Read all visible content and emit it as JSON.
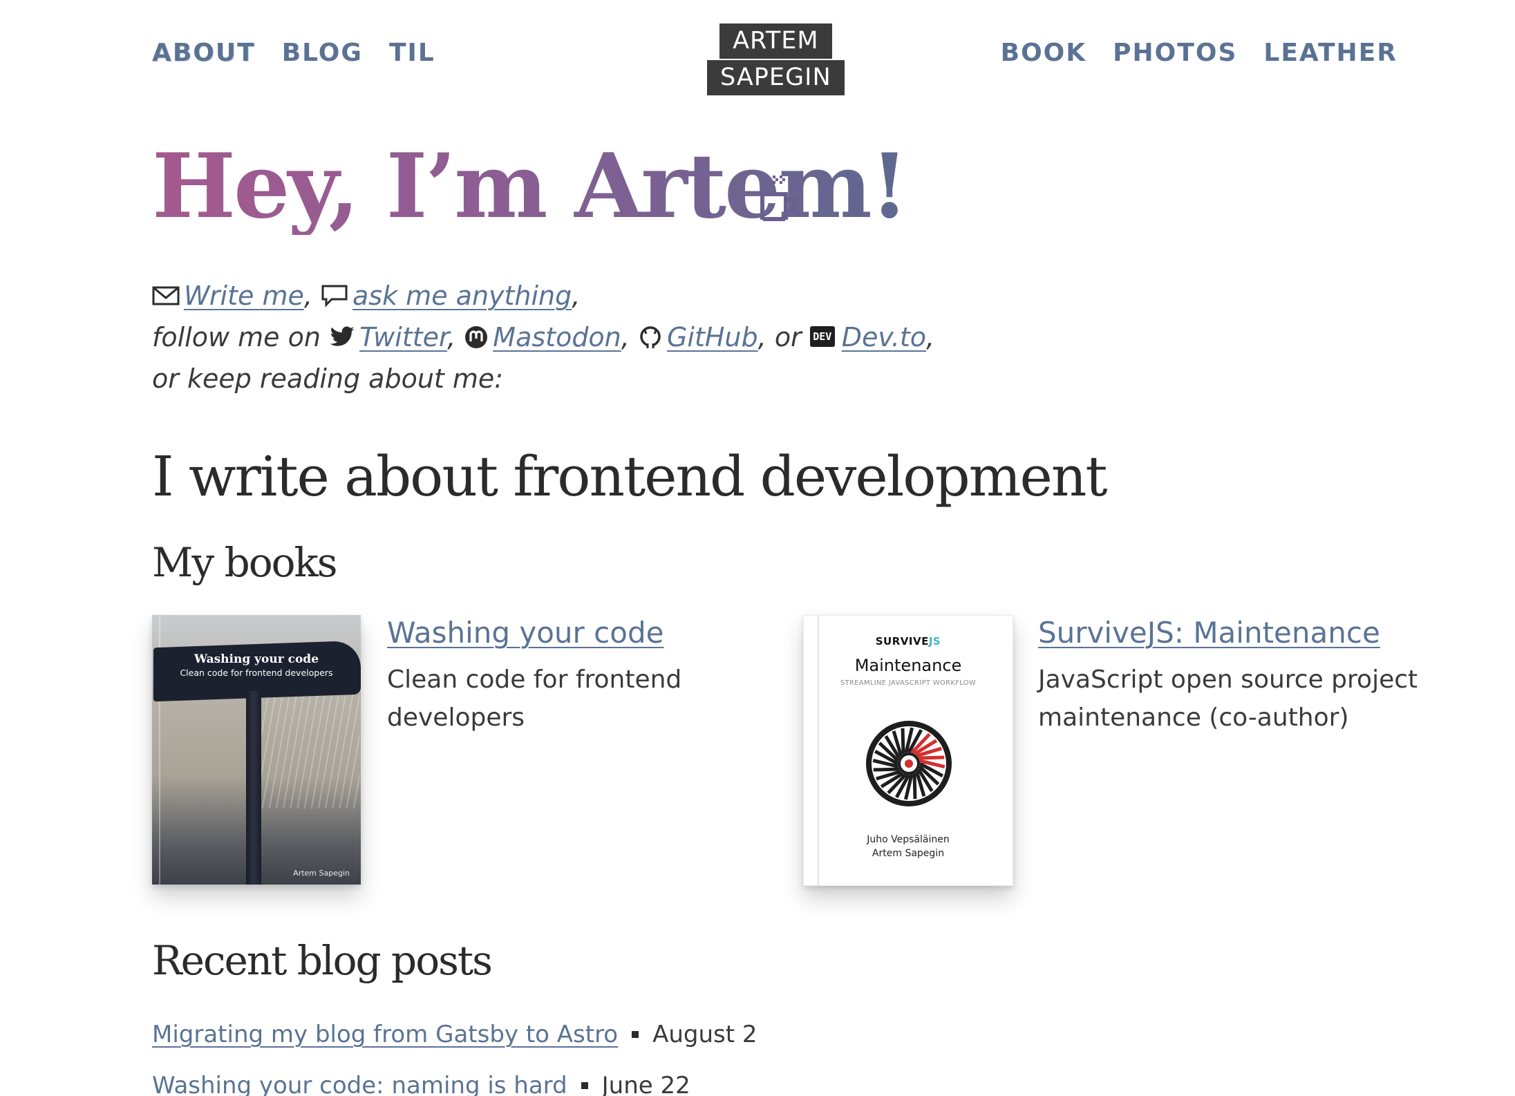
{
  "nav": {
    "left": [
      {
        "label": "ABOUT",
        "active": true
      },
      {
        "label": "BLOG",
        "active": false
      },
      {
        "label": "TIL",
        "active": false
      }
    ],
    "right": [
      {
        "label": "BOOK"
      },
      {
        "label": "PHOTOS"
      },
      {
        "label": "LEATHER"
      }
    ]
  },
  "logo": {
    "line1": "ARTEM",
    "line2": "SAPEGIN"
  },
  "hero": {
    "title": "Hey, I’m Artem!",
    "icon": "coffee-cup-icon"
  },
  "intro": {
    "write_me": "Write me",
    "ask": "ask me anything",
    "follow_prefix": "follow me on",
    "twitter": "Twitter",
    "mastodon": "Mastodon",
    "github": "GitHub",
    "or_text": "or",
    "devto": "Dev.to",
    "devto_badge": "DEV",
    "keep_reading": "or keep reading about me:"
  },
  "sections": {
    "frontend": "I write about frontend development",
    "books": "My books",
    "posts": "Recent blog posts"
  },
  "books": [
    {
      "title": "Washing your code",
      "description": "Clean code for frontend developers",
      "cover_title": "Washing your code",
      "cover_subtitle": "Clean code for frontend developers",
      "cover_author": "Artem Sapegin"
    },
    {
      "title": "SurviveJS: Maintenance",
      "description": "JavaScript open source project maintenance (co-author)",
      "cover_brand": "SURVIVE",
      "cover_brand_js": "JS",
      "cover_title": "Maintenance",
      "cover_subtitle": "STREAMLINE JAVASCRIPT WORKFLOW",
      "cover_author_1": "Juho Vepsäläinen",
      "cover_author_2": "Artem Sapegin"
    }
  ],
  "posts": [
    {
      "title": "Migrating my blog from Gatsby to Astro",
      "date": "August 2"
    },
    {
      "title": "Washing your code: naming is hard",
      "date": "June 22"
    }
  ],
  "colors": {
    "link": "#5a7394",
    "title_gradient_start": "#a45a8e",
    "title_gradient_end": "#5d6890",
    "logo_bg": "#3b3b3b",
    "text": "#2b2b2b"
  }
}
